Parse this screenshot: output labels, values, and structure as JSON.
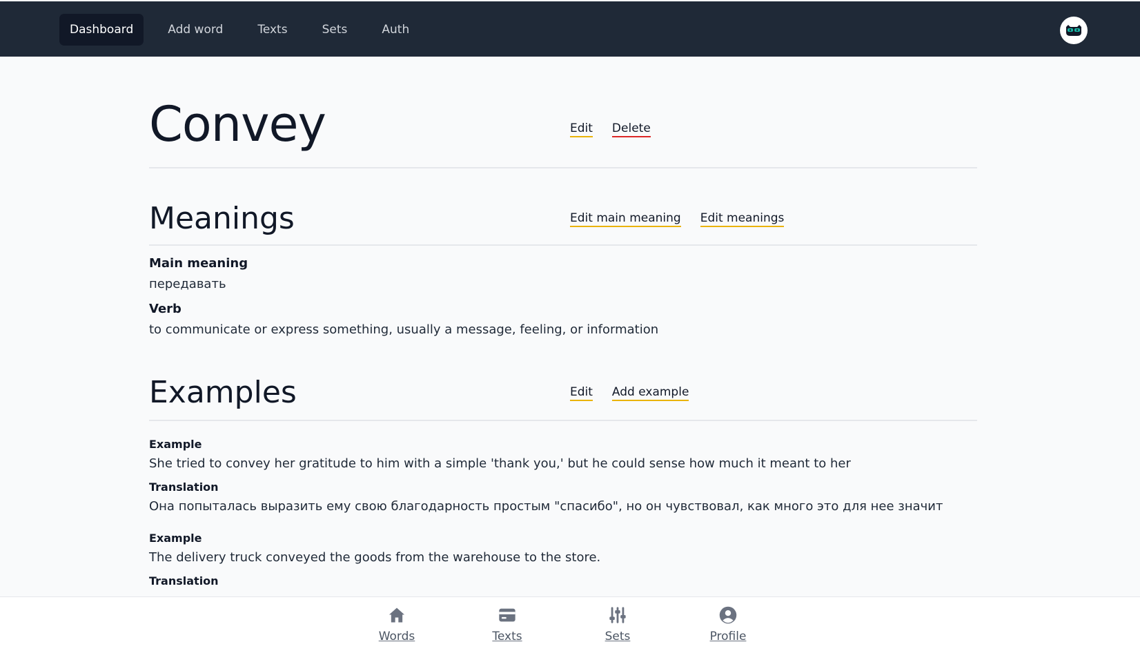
{
  "nav": {
    "items": [
      {
        "label": "Dashboard",
        "active": true
      },
      {
        "label": "Add word",
        "active": false
      },
      {
        "label": "Texts",
        "active": false
      },
      {
        "label": "Sets",
        "active": false
      },
      {
        "label": "Auth",
        "active": false
      }
    ]
  },
  "word": {
    "title": "Convey",
    "edit_label": "Edit",
    "delete_label": "Delete"
  },
  "meanings": {
    "title": "Meanings",
    "edit_main_label": "Edit main meaning",
    "edit_meanings_label": "Edit meanings",
    "main_label": "Main meaning",
    "main_value": "передавать",
    "part_of_speech": "Verb",
    "definition": "to communicate or express something, usually a message, feeling, or information"
  },
  "examples": {
    "title": "Examples",
    "edit_label": "Edit",
    "add_label": "Add example",
    "items": [
      {
        "example_label": "Example",
        "example": "She tried to convey her gratitude to him with a simple 'thank you,' but he could sense how much it meant to her",
        "translation_label": "Translation",
        "translation": "Она попыталась выразить ему свою благодарность простым \"спасибо\", но он чувствовал, как много это для нее значит"
      },
      {
        "example_label": "Example",
        "example": "The delivery truck conveyed the goods from the warehouse to the store.",
        "translation_label": "Translation",
        "translation": ""
      }
    ]
  },
  "bottom_nav": {
    "items": [
      {
        "label": "Words",
        "icon": "home-icon"
      },
      {
        "label": "Texts",
        "icon": "card-icon"
      },
      {
        "label": "Sets",
        "icon": "sliders-icon"
      },
      {
        "label": "Profile",
        "icon": "user-circle-icon"
      }
    ]
  },
  "colors": {
    "topbar_bg": "#1f2937",
    "active_nav_bg": "#111827",
    "edit_underline": "#eab308",
    "delete_underline": "#dc2626",
    "page_bg": "#f9fafb"
  }
}
